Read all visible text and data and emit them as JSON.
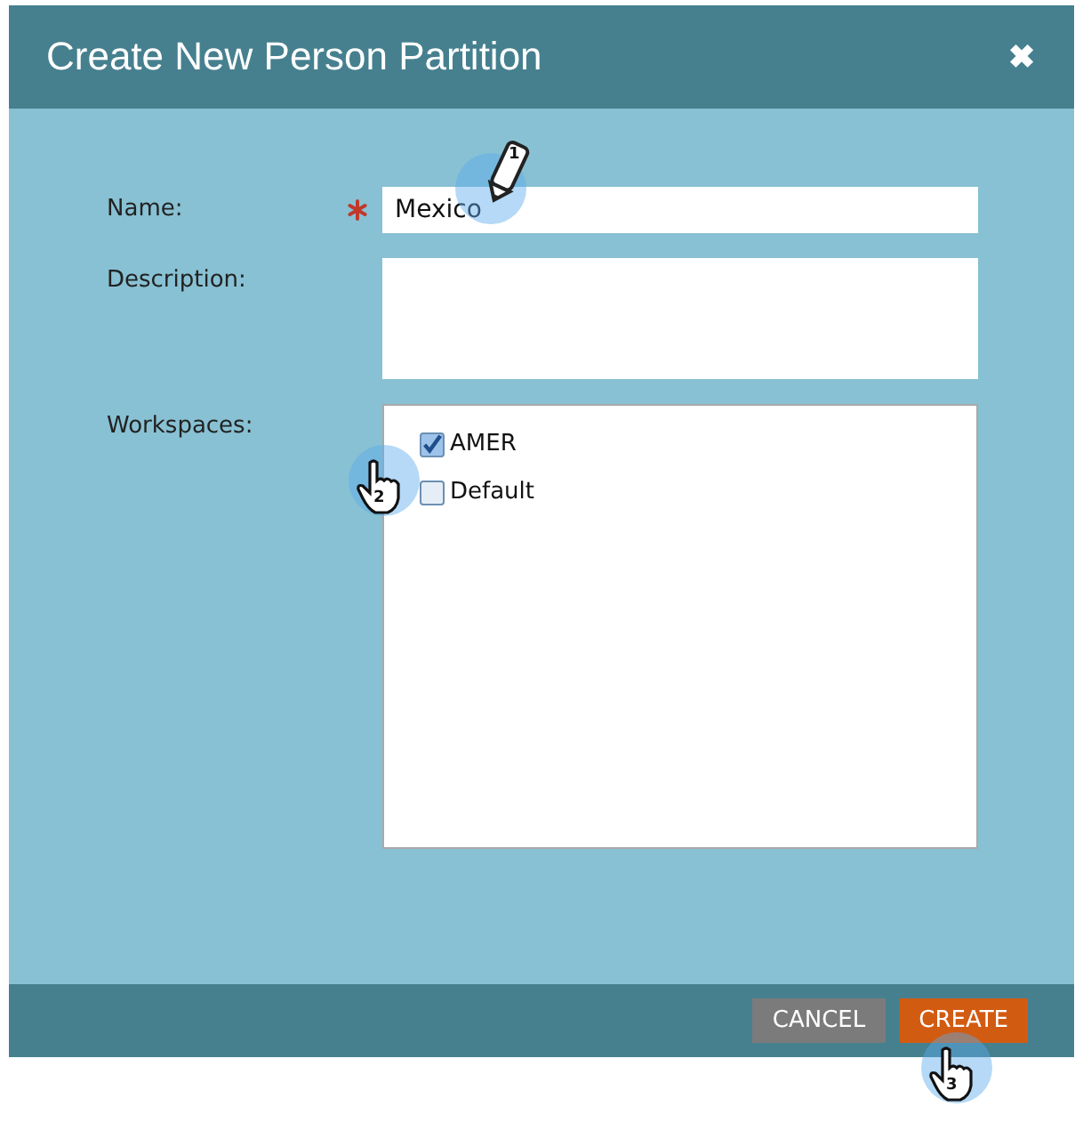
{
  "window": {
    "title": "Create New Person Partition",
    "close": "✖"
  },
  "form": {
    "name": {
      "label": "Name:",
      "required": true,
      "value": "Mexico"
    },
    "description": {
      "label": "Description:"
    },
    "workspaces": {
      "label": "Workspaces:",
      "items": [
        {
          "label": "AMER",
          "checked": true
        },
        {
          "label": "Default",
          "checked": false
        }
      ]
    }
  },
  "buttons": [
    {
      "label": "CANCEL",
      "kind": "secondary"
    },
    {
      "label": "CREATE",
      "kind": "primary"
    }
  ],
  "annotations": [
    {
      "kind": "pencil",
      "step": "1"
    },
    {
      "kind": "hand",
      "step": "2"
    },
    {
      "kind": "hand",
      "step": "3"
    }
  ]
}
